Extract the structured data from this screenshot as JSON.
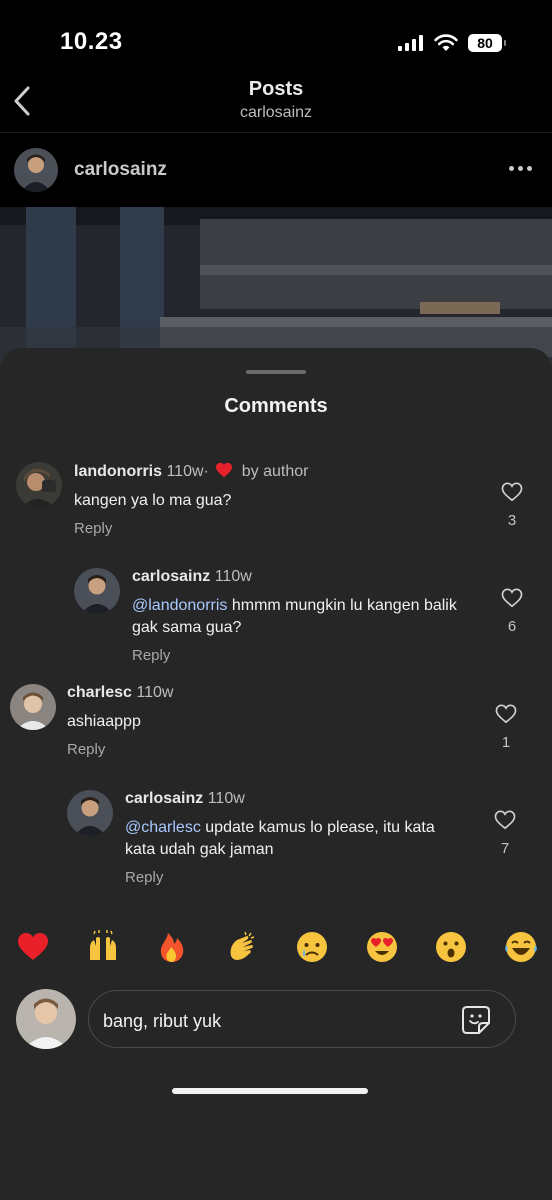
{
  "status_bar": {
    "time": "10.23",
    "battery": "80",
    "icons": [
      "cellular-icon",
      "wifi-icon",
      "battery-icon"
    ]
  },
  "nav": {
    "title": "Posts",
    "subtitle": "carlosainz",
    "back_icon": "chevron-left-icon"
  },
  "post": {
    "username": "carlosainz",
    "more_icon": "ellipsis-icon"
  },
  "sheet": {
    "title": "Comments"
  },
  "comments": [
    {
      "username": "landonorris",
      "time": "110w",
      "separator": "·",
      "liked_by": "by author",
      "text": "kangen ya lo ma gua?",
      "reply": "Reply",
      "likes": "3"
    },
    {
      "username": "carlosainz",
      "time": "110w",
      "mention": "@landonorris",
      "text": " hmmm mungkin lu kangen balik gak sama gua?",
      "reply": "Reply",
      "likes": "6"
    },
    {
      "username": "charlesc",
      "time": "110w",
      "text": "ashiaappp",
      "reply": "Reply",
      "likes": "1"
    },
    {
      "username": "carlosainz",
      "time": "110w",
      "mention": "@charlesc",
      "text": " update kamus lo please, itu kata kata udah gak jaman",
      "reply": "Reply",
      "likes": "7"
    }
  ],
  "emoji_bar": [
    "❤️",
    "🙌",
    "🔥",
    "👏",
    "😢",
    "😍",
    "😮",
    "😂"
  ],
  "input": {
    "value": "bang, ribut yuk",
    "sticker_icon": "sticker-icon"
  },
  "colors": {
    "background": "#000000",
    "sheet": "#262626",
    "mention": "#a8c8ff",
    "heart_red": "#e8202a"
  }
}
